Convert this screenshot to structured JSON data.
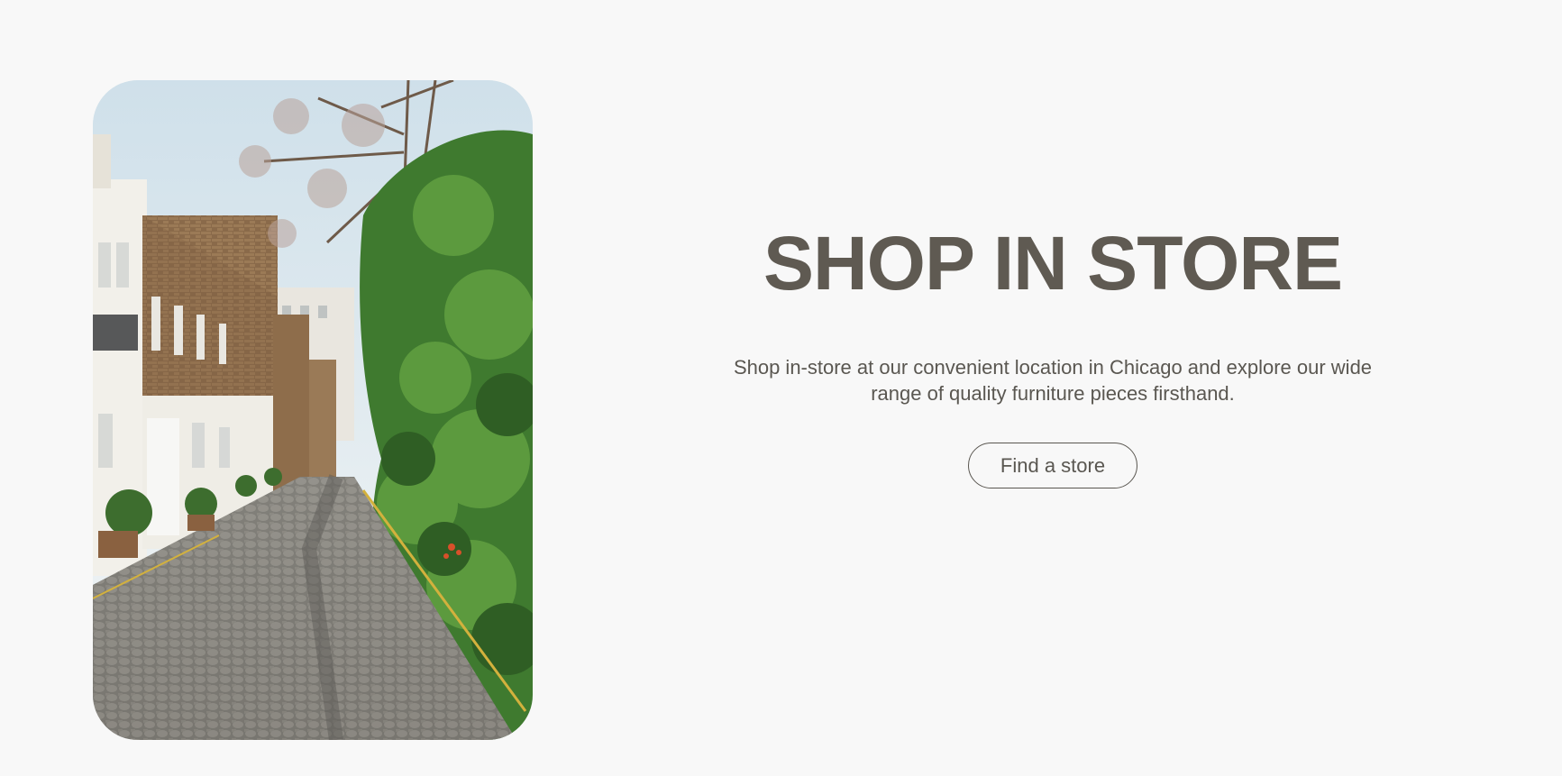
{
  "hero": {
    "image_icon": "street-photo-icon",
    "title": "SHOP IN STORE",
    "description": "Shop in-store at our convenient location in Chicago and explore our wide range of quality furniture pieces firsthand.",
    "cta_label": "Find a store"
  },
  "colors": {
    "background": "#f8f8f8",
    "title": "#5f5a52",
    "text": "#5a5751"
  }
}
